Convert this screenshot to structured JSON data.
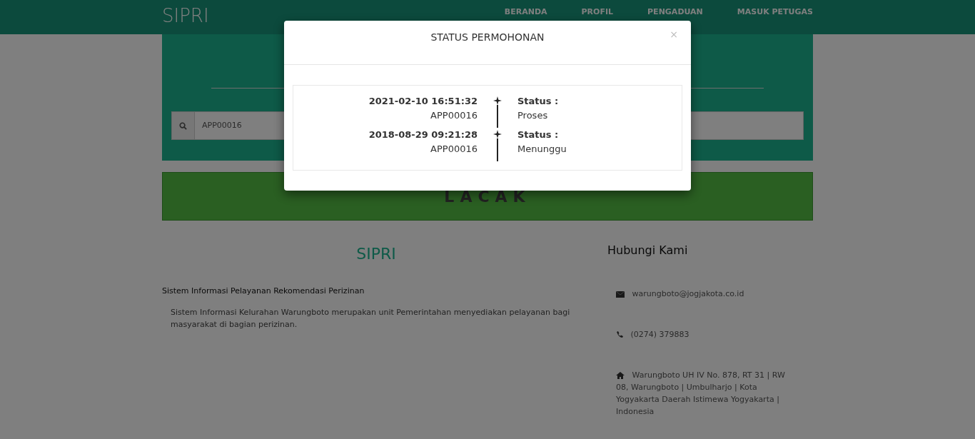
{
  "navbar": {
    "brand": "SIPRI",
    "links": [
      {
        "label": "BERANDA"
      },
      {
        "label": "PROFIL"
      },
      {
        "label": "PENGADUAN"
      },
      {
        "label": "MASUK PETUGAS"
      }
    ]
  },
  "search": {
    "value": "APP00016"
  },
  "track_button": "LACAK",
  "about": {
    "title": "SIPRI",
    "subtitle": "Sistem Informasi Pelayanan Rekomendasi Perizinan",
    "description": "Sistem Informasi Kelurahan Warungboto merupakan unit Pemerintahan menyediakan pelayanan bagi masyarakat di bagian perizinan."
  },
  "contact": {
    "title": "Hubungi Kami",
    "items": [
      {
        "kind": "email",
        "text": "warungboto@jogjakota.co.id"
      },
      {
        "kind": "phone",
        "text": "(0274) 379883"
      },
      {
        "kind": "address",
        "text": "Warungboto UH IV No. 878, RT 31 | RW 08, Warungboto | Umbulharjo | Kota Yogyakarta Daerah Istimewa Yogyakarta | Indonesia"
      }
    ]
  },
  "modal": {
    "title": "STATUS PERMOHONAN",
    "close": "×",
    "entries": [
      {
        "datetime": "2021-02-10 16:51:32",
        "code": "APP00016",
        "status_label": "Status :",
        "status": "Proses"
      },
      {
        "datetime": "2018-08-29 09:21:28",
        "code": "APP00016",
        "status_label": "Status :",
        "status": "Menunggu"
      }
    ]
  }
}
